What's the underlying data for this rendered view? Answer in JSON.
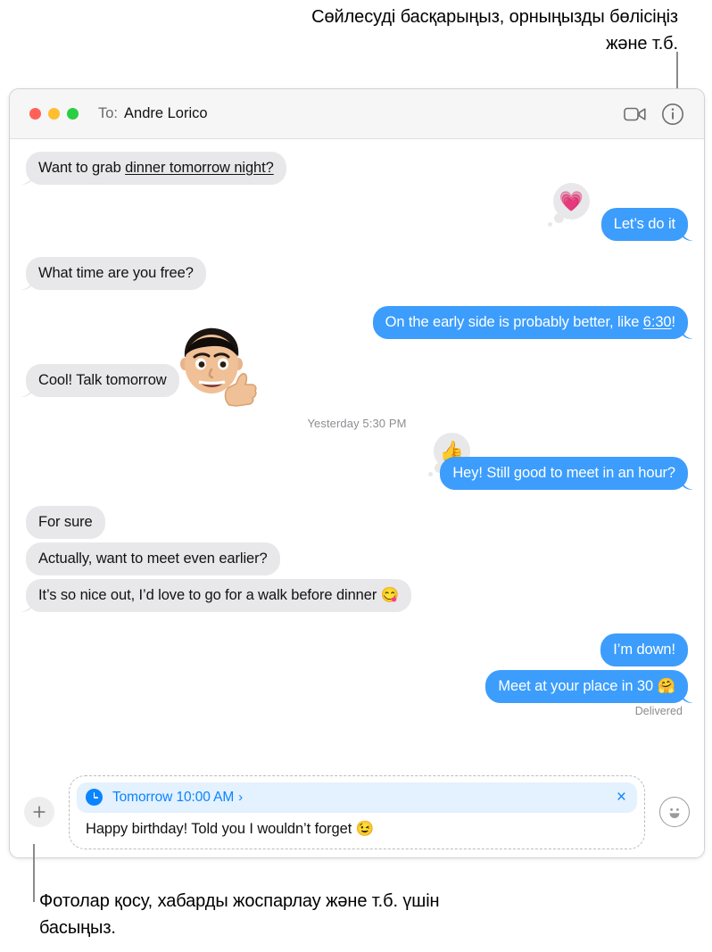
{
  "callouts": {
    "top": "Сөйлесуді басқарыңыз, орныңызды бөлісіңіз және т.б.",
    "bottom": "Фотолар қосу, хабарды жоспарлау және т.б. үшін басыңыз."
  },
  "window": {
    "traffic_lights": {
      "close": "close-button",
      "minimize": "minimize-button",
      "zoom": "zoom-button"
    },
    "to_label": "To:",
    "recipient": "Andre Lorico",
    "facetime_icon": "video-camera-icon",
    "details_icon": "info-circle-icon"
  },
  "conversation": {
    "messages": [
      {
        "side": "in",
        "text_before": "Want to grab ",
        "link": "dinner tomorrow night?",
        "text_after": "",
        "tapback": null
      },
      {
        "side": "out",
        "text_before": "Let’s do it",
        "link": "",
        "text_after": "",
        "tapback": "💗"
      },
      {
        "side": "in",
        "text_before": "What time are you free?",
        "link": "",
        "text_after": "",
        "tapback": null
      },
      {
        "side": "out",
        "text_before": "On the early side is probably better, like ",
        "link": "6:30",
        "text_after": "!",
        "tapback": null
      },
      {
        "side": "in",
        "text_before": "Cool! Talk tomorrow",
        "link": "",
        "text_after": "",
        "tapback": null,
        "sticker": "🧑‍🦱👍"
      }
    ],
    "timestamp": "Yesterday 5:30 PM",
    "messages_after": [
      {
        "side": "out",
        "text_before": "Hey! Still good to meet in an hour?",
        "link": "",
        "text_after": "",
        "tapback": "👍"
      },
      {
        "side": "in",
        "text_before": "For sure",
        "link": "",
        "text_after": "",
        "tapback": null
      },
      {
        "side": "in",
        "text_before": "Actually, want to meet even earlier?",
        "link": "",
        "text_after": "",
        "tapback": null
      },
      {
        "side": "in",
        "text_before": "It’s so nice out, I’d love to go for a walk before dinner 😋",
        "link": "",
        "text_after": "",
        "tapback": null
      },
      {
        "side": "out",
        "text_before": "I’m down!",
        "link": "",
        "text_after": "",
        "tapback": null
      },
      {
        "side": "out",
        "text_before": "Meet at your place in 30 🤗",
        "link": "",
        "text_after": "",
        "tapback": null
      }
    ],
    "delivered_status": "Delivered"
  },
  "compose": {
    "add_button_icon": "plus-icon",
    "emoji_button_icon": "smiley-face-icon",
    "schedule": {
      "clock_icon": "clock-icon",
      "label": "Tomorrow 10:00 AM",
      "chevron": "›",
      "close_icon": "×"
    },
    "draft_text": "Happy birthday! Told you I wouldn’t forget 😉"
  },
  "colors": {
    "bubble_out": "#3c9dfc",
    "bubble_in": "#e8e8ea",
    "accent_blue": "#0a84ff",
    "banner_bg": "#e4f1fe",
    "titlebar_bg": "#f6f6f6"
  }
}
